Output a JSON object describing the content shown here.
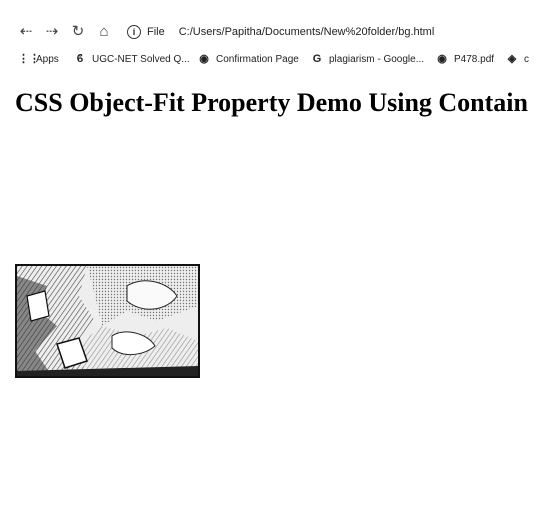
{
  "browser": {
    "url_scheme_label": "File",
    "url": "C:/Users/Papitha/Documents/New%20folder/bg.html",
    "bookmarks": [
      {
        "icon": "apps-grid-icon",
        "label": "Apps"
      },
      {
        "icon": "site-favicon-icon",
        "label": "UGC-NET Solved Q..."
      },
      {
        "icon": "globe-icon",
        "label": "Confirmation Page"
      },
      {
        "icon": "google-icon",
        "label": "plagiarism - Google..."
      },
      {
        "icon": "globe-icon",
        "label": "P478.pdf"
      },
      {
        "icon": "favicon-icon",
        "label": "c"
      }
    ]
  },
  "page": {
    "title": "CSS Object-Fit Property Demo Using Contain"
  }
}
